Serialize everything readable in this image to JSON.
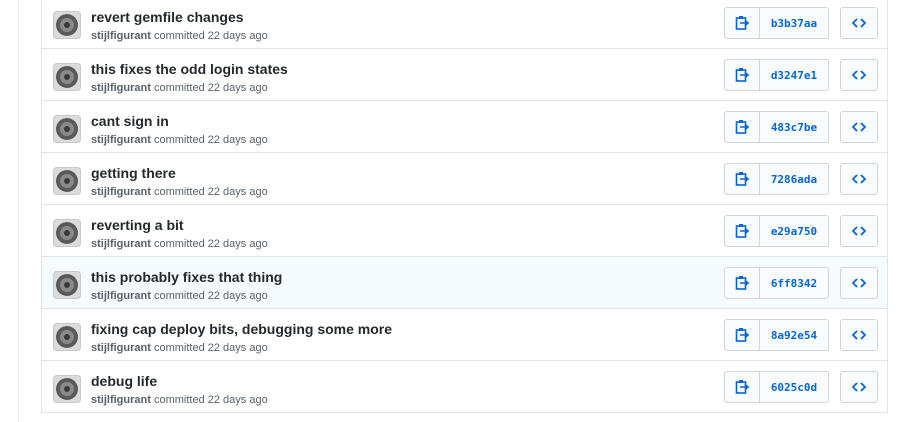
{
  "commits": [
    {
      "message": "revert gemfile changes",
      "author": "stijlfigurant",
      "committed": "committed 22 days ago",
      "sha": "b3b37aa"
    },
    {
      "message": "this fixes the odd login states",
      "author": "stijlfigurant",
      "committed": "committed 22 days ago",
      "sha": "d3247e1"
    },
    {
      "message": "cant sign in",
      "author": "stijlfigurant",
      "committed": "committed 22 days ago",
      "sha": "483c7be"
    },
    {
      "message": "getting there",
      "author": "stijlfigurant",
      "committed": "committed 22 days ago",
      "sha": "7286ada"
    },
    {
      "message": "reverting a bit",
      "author": "stijlfigurant",
      "committed": "committed 22 days ago",
      "sha": "e29a750"
    },
    {
      "message": "this probably fixes that thing",
      "author": "stijlfigurant",
      "committed": "committed 22 days ago",
      "sha": "6ff8342"
    },
    {
      "message": "fixing cap deploy bits, debugging some more",
      "author": "stijlfigurant",
      "committed": "committed 22 days ago",
      "sha": "8a92e54"
    },
    {
      "message": "debug life",
      "author": "stijlfigurant",
      "committed": "committed 22 days ago",
      "sha": "6025c0d"
    }
  ],
  "icons": {
    "copy": "clipboard-icon",
    "browse": "code-icon",
    "avatar": "avatar-icon"
  },
  "colors": {
    "link": "#0366d6",
    "text": "#24292e",
    "muted": "#586069",
    "border": "#e1e4e8",
    "highlight_row": "#f6fbff"
  }
}
